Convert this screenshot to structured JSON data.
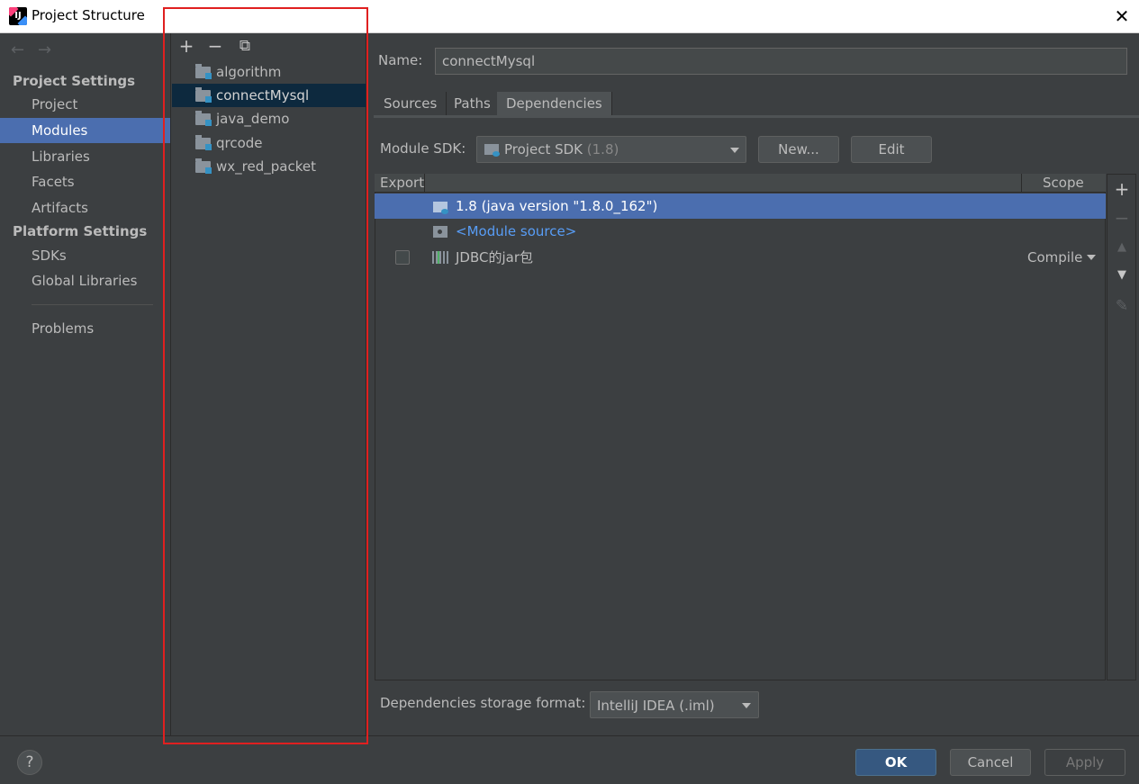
{
  "window": {
    "title": "Project Structure",
    "app_icon_text": "IJ"
  },
  "nav": {
    "back_icon": "←",
    "forward_icon": "→",
    "project_settings_header": "Project Settings",
    "project_settings_items": [
      "Project",
      "Modules",
      "Libraries",
      "Facets",
      "Artifacts"
    ],
    "platform_settings_header": "Platform Settings",
    "platform_settings_items": [
      "SDKs",
      "Global Libraries"
    ],
    "problems": "Problems",
    "selected": "Modules"
  },
  "modules": {
    "toolbar": {
      "add": "+",
      "remove": "−",
      "copy": "⧉"
    },
    "items": [
      "algorithm",
      "connectMysql",
      "java_demo",
      "qrcode",
      "wx_red_packet"
    ],
    "selected": "connectMysql"
  },
  "detail": {
    "name_label": "Name:",
    "name_value": "connectMysql",
    "tabs": [
      "Sources",
      "Paths",
      "Dependencies"
    ],
    "selected_tab": "Dependencies",
    "module_sdk_label": "Module SDK:",
    "module_sdk_value": "Project SDK",
    "module_sdk_version": "(1.8)",
    "new_button": "New...",
    "edit_button": "Edit",
    "table": {
      "col_export": "Export",
      "col_scope": "Scope",
      "rows": [
        {
          "text": "1.8 (java version \"1.8.0_162\")",
          "icon": "sdk-folder-icon"
        },
        {
          "text": "<Module source>",
          "icon": "module-source-icon"
        },
        {
          "text": "JDBC的jar包",
          "icon": "library-icon",
          "scope": "Compile",
          "export": false
        }
      ]
    },
    "right_toolbar": {
      "add": "+",
      "remove": "−",
      "up": "▲",
      "down": "▼",
      "edit": "✎"
    },
    "storage_label": "Dependencies storage format:",
    "storage_value": "IntelliJ IDEA (.iml)"
  },
  "footer": {
    "help": "?",
    "ok": "OK",
    "cancel": "Cancel",
    "apply": "Apply"
  },
  "colors": {
    "accent": "#4b6eaf",
    "background": "#3c3f41",
    "highlight_box": "#e02020",
    "link": "#589df6"
  }
}
